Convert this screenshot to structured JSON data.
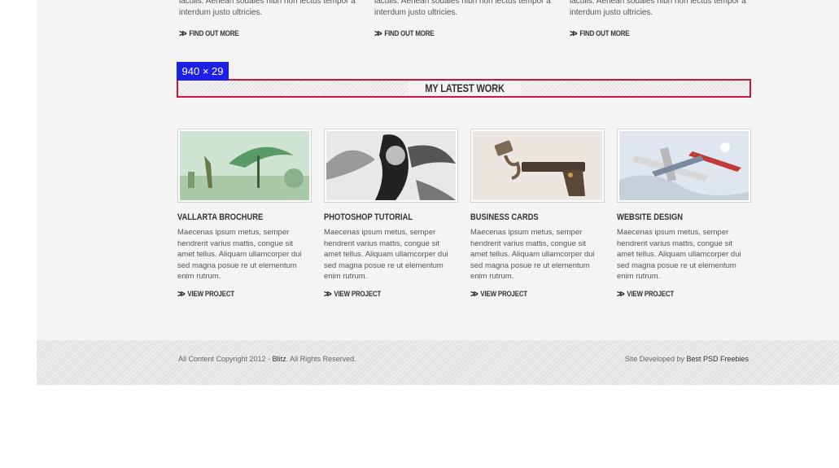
{
  "services": [
    {
      "text": "iaculis. Aenean sodales nibh non lectus tempor a interdum justo ultricies.",
      "link": "FIND OUT MORE"
    },
    {
      "text": "iaculis. Aenean sodales nibh non lectus tempor a interdum justo ultricies.",
      "link": "FIND OUT MORE"
    },
    {
      "text": "iaculis. Aenean sodales nibh non lectus tempor a interdum justo ultricies.",
      "link": "FIND OUT MORE"
    }
  ],
  "dimension_badge": "940 × 29",
  "section": {
    "title": "MY LATEST WORK"
  },
  "projects": [
    {
      "title": "VALLARTA BROCHURE",
      "desc": "Maecenas ipsum metus, semper hendrerit varius mattis, congue sit amet tellus. Aliquam ullamcorper dui sed magna posue re ut elementum enim rutrum.",
      "link": "VIEW PROJECT",
      "image": "surreal-landscape"
    },
    {
      "title": "PHOTOSHOP TUTORIAL",
      "desc": "Maecenas ipsum metus, semper hendrerit varius mattis, congue sit amet tellus. Aliquam ullamcorper dui sed magna posue re ut elementum enim rutrum.",
      "link": "VIEW PROJECT",
      "image": "smoke-portrait"
    },
    {
      "title": "BUSINESS CARDS",
      "desc": "Maecenas ipsum metus, semper hendrerit varius mattis, congue sit amet tellus. Aliquam ullamcorper dui sed magna posue re ut elementum enim rutrum.",
      "link": "VIEW PROJECT",
      "image": "vintage-pistol"
    },
    {
      "title": "WEBSITE DESIGN",
      "desc": "Maecenas ipsum metus, semper hendrerit varius mattis, congue sit amet tellus. Aliquam ullamcorper dui sed magna posue re ut elementum enim rutrum.",
      "link": "VIEW PROJECT",
      "image": "airplane-collage"
    }
  ],
  "footer": {
    "copyright_prefix": "All Content Copyright 2012 - ",
    "copyright_brand": "Blitz",
    "copyright_suffix": ". All Rights Reserved.",
    "dev_prefix": "Site Developed by ",
    "dev_link": "Best PSD Freebies"
  },
  "colors": {
    "highlight_border": "#c8173b",
    "badge_bg": "#1d1ee6"
  }
}
